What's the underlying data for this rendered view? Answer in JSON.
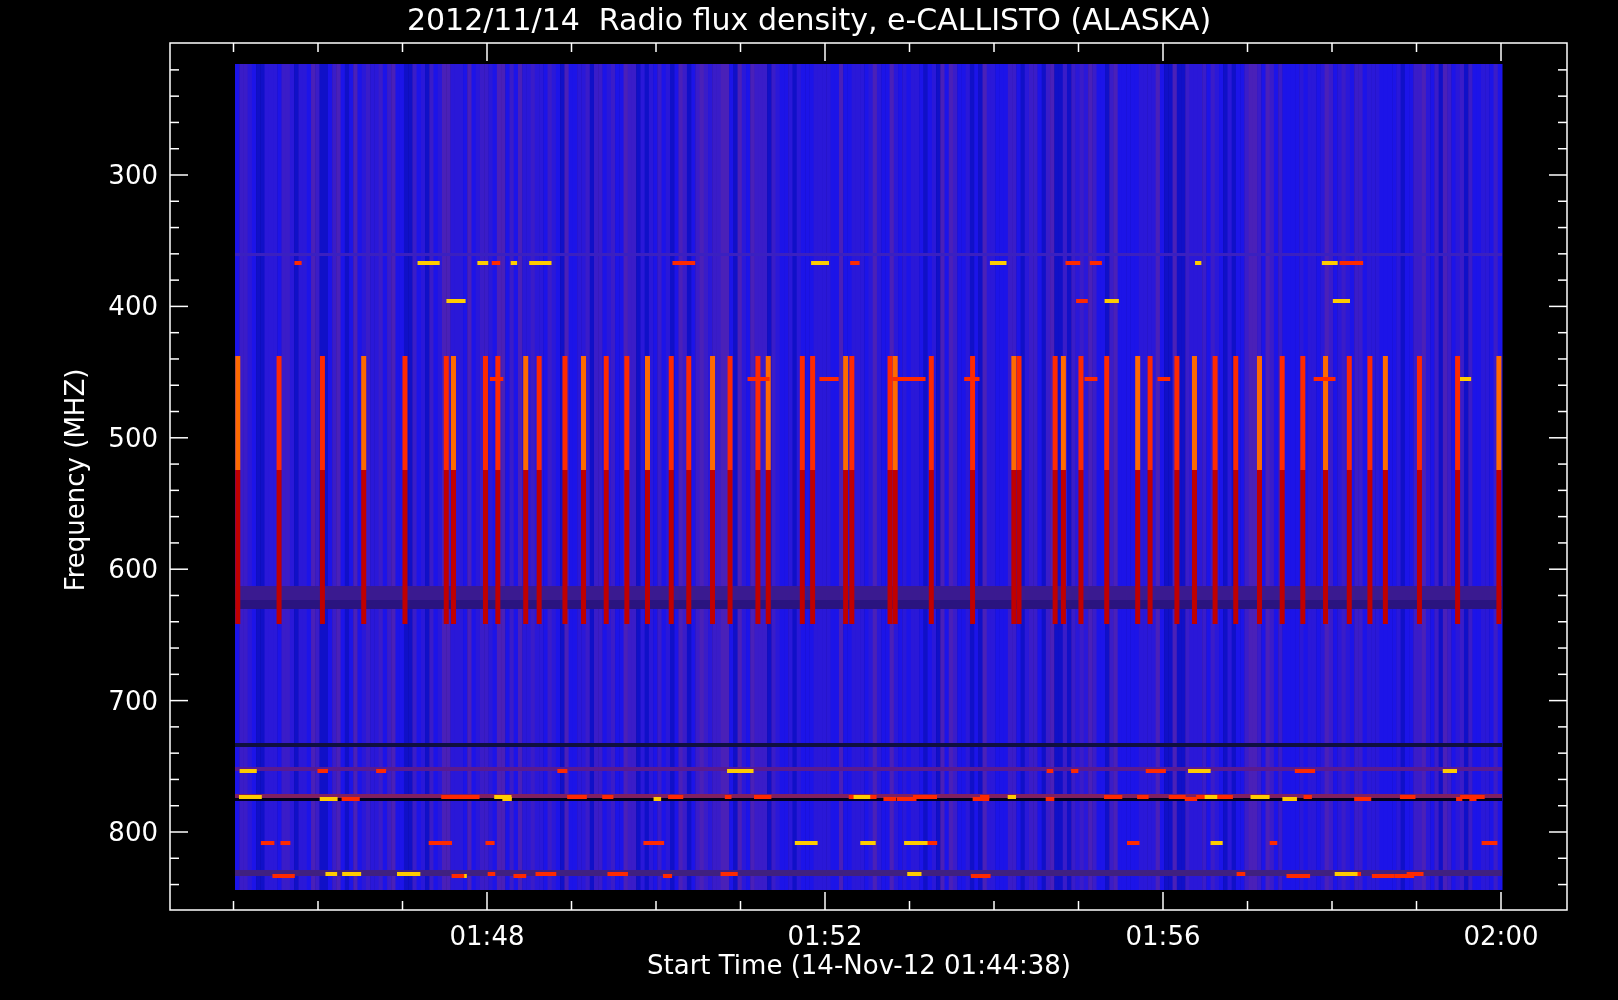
{
  "plot": {
    "title": "2012/11/14  Radio flux density, e-CALLISTO (ALASKA)",
    "y_axis": {
      "title": "Frequency (MHZ)",
      "tick_labels": [
        "300",
        "400",
        "500",
        "600",
        "700",
        "800"
      ]
    },
    "x_axis": {
      "title": "Start Time (14-Nov-12 01:44:38)",
      "tick_labels": [
        "01:48",
        "01:52",
        "01:56",
        "02:00"
      ]
    }
  }
}
